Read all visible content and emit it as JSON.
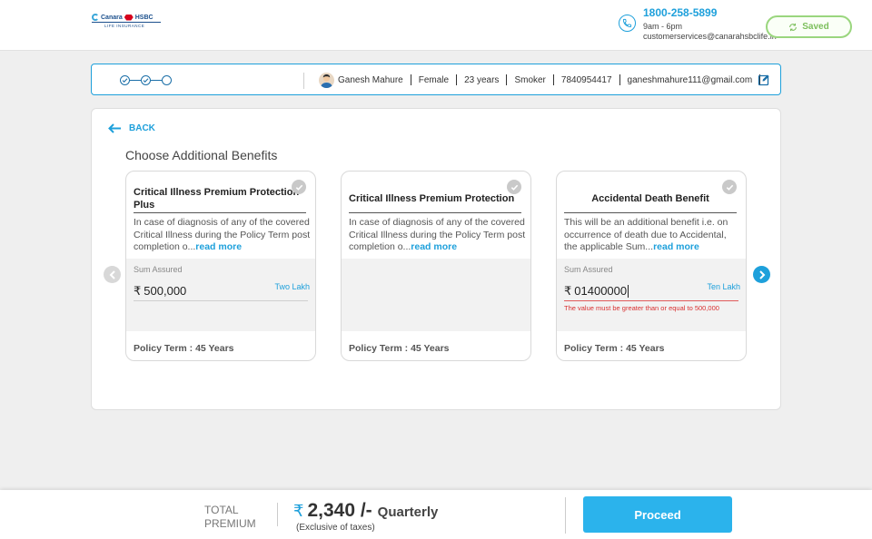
{
  "header": {
    "logo": {
      "brand": "Canara",
      "partner": "HSBC",
      "tagline": "LIFE INSURANCE"
    },
    "contact": {
      "phone": "1800-258-5899",
      "hours": "9am - 6pm",
      "email": "customerservices@canarahsbclife.in"
    },
    "saved_label": "Saved",
    "saved_color": "#9ad67e"
  },
  "infobar": {
    "steps_total": 3,
    "steps_completed": 2,
    "user": {
      "name": "Ganesh Mahure",
      "gender": "Female",
      "age": "23 years",
      "smoker": "Smoker",
      "phone": "7840954417",
      "email": "ganeshmahure111@gmail.com"
    }
  },
  "main": {
    "back_label": "BACK",
    "title": "Choose Additional Benefits",
    "cards": [
      {
        "title": "Critical Illness Premium Protection Plus",
        "desc": "In case of diagnosis of any of the covered Critical Illness during the Policy Term post completion o...",
        "read_more": "read more",
        "sum_label": "Sum Assured",
        "sum_value": "500,000",
        "sum_words": "Two Lakh",
        "policy_term": "Policy Term : 45 Years"
      },
      {
        "title": "Critical Illness Premium Protection",
        "desc": "In case of diagnosis of any of the covered Critical Illness during the Policy Term post completion o...",
        "read_more": "read more",
        "policy_term": "Policy Term : 45 Years"
      },
      {
        "title": "Accidental Death Benefit",
        "desc": "This will be an additional benefit i.e. on occurrence of death due to Accidental, the applicable Sum...",
        "read_more": "read more",
        "sum_label": "Sum Assured",
        "sum_value": "01400000",
        "sum_words": "Ten Lakh",
        "error": "The value must be greater than or equal to 500,000",
        "policy_term": "Policy Term : 45 Years"
      }
    ]
  },
  "footer": {
    "total_label_line1": "TOTAL",
    "total_label_line2": "PREMIUM",
    "currency": "₹",
    "amount": "2,340 /-",
    "frequency": "Quarterly",
    "tax_note": "(Exclusive of taxes)",
    "proceed_label": "Proceed"
  },
  "colors": {
    "accent": "#1ea0db",
    "error": "#d93030",
    "proceed": "#2bb3ec"
  }
}
